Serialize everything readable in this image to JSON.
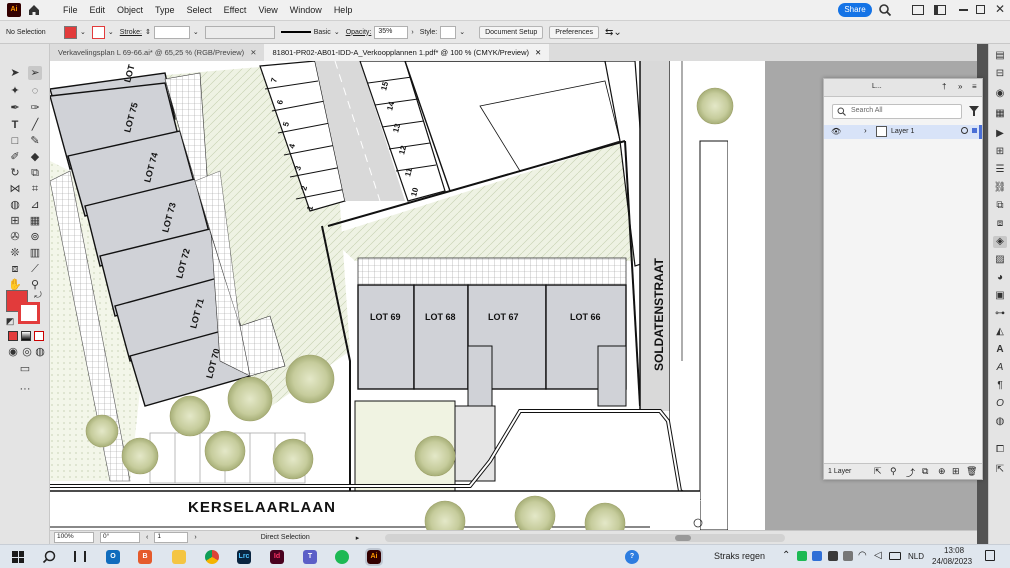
{
  "app": {
    "name": "Adobe Illustrator",
    "logo": "Ai"
  },
  "menu": [
    "File",
    "Edit",
    "Object",
    "Type",
    "Select",
    "Effect",
    "View",
    "Window",
    "Help"
  ],
  "top_right": {
    "share_label": "Share",
    "search_icon": "search-icon",
    "window_icons": [
      "arrange-icon",
      "panel-icon"
    ],
    "controls": [
      "minimize",
      "maximize",
      "close"
    ]
  },
  "control_bar": {
    "selection": "No Selection",
    "stroke_label": "Stroke:",
    "brush": "Basic",
    "opacity_label": "Opacity:",
    "opacity_value": "35%",
    "style_label": "Style:",
    "document_setup": "Document Setup",
    "preferences": "Preferences",
    "fill_color": "#e23b3b"
  },
  "tabs": [
    {
      "label": "Verkavelingsplan L 69-66.ai* @ 65,25 % (RGB/Preview)",
      "active": false
    },
    {
      "label": "81801-PR02-AB01-IDD-A_Verkoopplannen 1.pdf* @ 100 % (CMYK/Preview)",
      "active": true
    }
  ],
  "plan": {
    "lots_left": [
      "LOT 75",
      "LOT 74",
      "LOT 73",
      "LOT 72",
      "LOT 71",
      "LOT 70"
    ],
    "lot_partial": "LOT",
    "lots_main": [
      "LOT 69",
      "LOT 68",
      "LOT 67",
      "LOT 66"
    ],
    "street_bottom": "KERSELAARLAAN",
    "street_right": "SOLDATENSTRAAT",
    "parking_left": [
      "7",
      "6",
      "5",
      "4",
      "3",
      "2",
      "1"
    ],
    "parking_right": [
      "15",
      "14",
      "13",
      "12",
      "11",
      "10"
    ]
  },
  "layers_panel": {
    "tab_label": "L...",
    "search_placeholder": "Search All",
    "layer_name": "Layer 1",
    "footer": "1 Layer",
    "accent": "#4a6fd6"
  },
  "status_bar": {
    "zoom": "100%",
    "rotation": "0°",
    "artboard": "1",
    "tool": "Direct Selection"
  },
  "taskbar": {
    "weather": "Straks regen",
    "language": "NLD",
    "time": "13:08",
    "date": "24/08/2023",
    "apps": [
      "windows-icon",
      "search-icon",
      "taskview-icon",
      "outlook-icon",
      "brave-icon",
      "folder-icon",
      "chrome-icon",
      "lightroom-icon",
      "indesign-icon",
      "teams-icon",
      "spotify-icon",
      "illustrator-icon"
    ]
  }
}
